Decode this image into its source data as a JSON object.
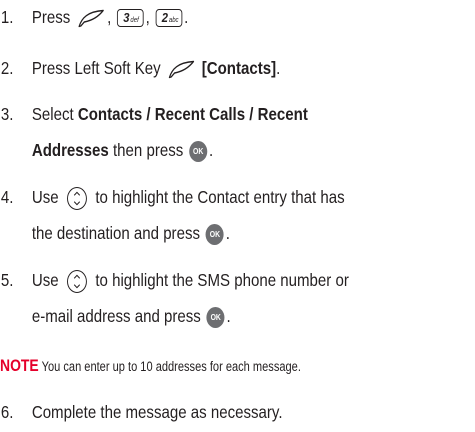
{
  "steps": [
    {
      "number": "1.",
      "text_a": "Press",
      "text_b": ",",
      "text_c": ",",
      "text_d": ".",
      "key_3": "3",
      "key_3_sub": "def",
      "key_2": "2",
      "key_2_sub": "abc"
    },
    {
      "number": "2.",
      "text_a": "Press Left Soft Key",
      "bold_a": "[Contacts]",
      "text_b": "."
    },
    {
      "number": "3.",
      "text_a": "Select",
      "bold_a": "Contacts / Recent Calls / Recent",
      "bold_b": "Addresses",
      "text_b": "then press",
      "text_c": "."
    },
    {
      "number": "4.",
      "text_a": "Use",
      "text_b": "to highlight the Contact entry that has",
      "text_c": "the destination and press",
      "text_d": "."
    },
    {
      "number": "5.",
      "text_a": "Use",
      "text_b": "to highlight the SMS phone number or",
      "text_c": "e-mail address and press",
      "text_d": "."
    },
    {
      "number": "6.",
      "text_a": "Complete the message as necessary."
    }
  ],
  "note": {
    "label": "NOTE",
    "text": "You can enter up to 10 addresses for each message."
  },
  "icons": {
    "ok_label": "OK"
  },
  "colors": {
    "note_label": "#e5002b",
    "text": "#231f20",
    "ok_key": "#6d6e71"
  }
}
